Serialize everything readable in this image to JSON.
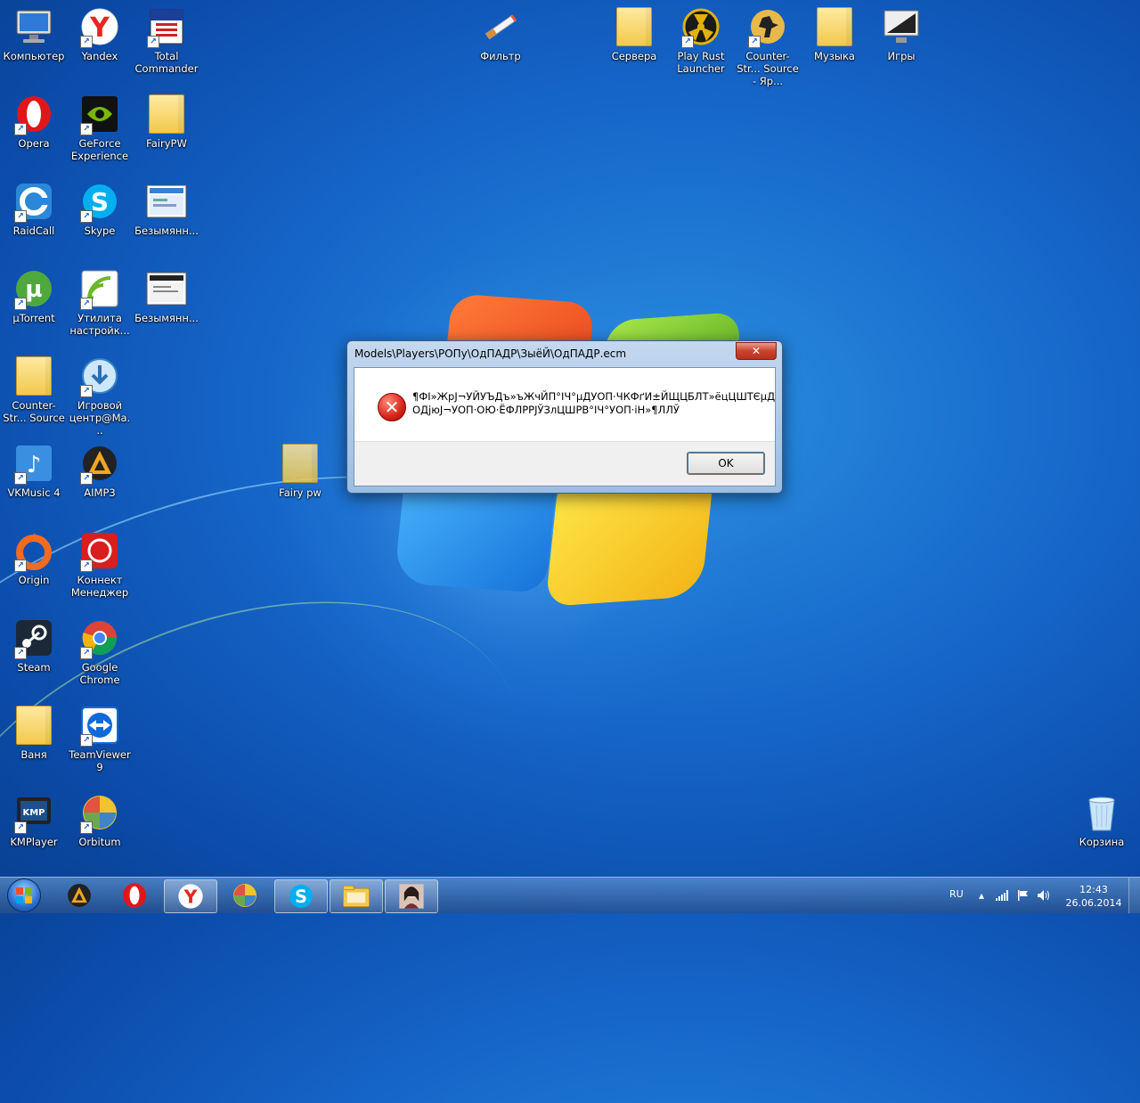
{
  "desktop": {
    "icons": [
      {
        "label": "Компьютер",
        "icon": "computer-icon"
      },
      {
        "label": "Yandex",
        "icon": "yandex-icon"
      },
      {
        "label": "Total Commander",
        "icon": "total-commander-icon"
      },
      {
        "label": "Фильтр",
        "icon": "cigarette-icon"
      },
      {
        "label": "Сервера",
        "icon": "folder-icon"
      },
      {
        "label": "Play Rust Launcher",
        "icon": "rust-icon"
      },
      {
        "label": "Counter-Str... Source - Яр...",
        "icon": "counter-strike-icon"
      },
      {
        "label": "Музыка",
        "icon": "music-folder-icon"
      },
      {
        "label": "Игры",
        "icon": "games-icon"
      },
      {
        "label": "Opera",
        "icon": "opera-icon"
      },
      {
        "label": "GeForce Experience",
        "icon": "geforce-icon"
      },
      {
        "label": "FairyPW",
        "icon": "folder-icon"
      },
      {
        "label": "RaidCall",
        "icon": "raidcall-icon"
      },
      {
        "label": "Skype",
        "icon": "skype-icon"
      },
      {
        "label": "Безымянн...",
        "icon": "image-file-icon"
      },
      {
        "label": "µTorrent",
        "icon": "utorrent-icon"
      },
      {
        "label": "Утилита настройк...",
        "icon": "wifi-utility-icon"
      },
      {
        "label": "Безымянн...",
        "icon": "image-file-icon"
      },
      {
        "label": "Counter-Str... Source",
        "icon": "folder-icon"
      },
      {
        "label": "Игровой центр@Ma...",
        "icon": "game-center-icon"
      },
      {
        "label": "Fairy pw",
        "icon": "folder-icon"
      },
      {
        "label": "VKMusic 4",
        "icon": "vkmusic-icon"
      },
      {
        "label": "AIMP3",
        "icon": "aimp-icon"
      },
      {
        "label": "Origin",
        "icon": "origin-icon"
      },
      {
        "label": "Коннект Менеджер",
        "icon": "connect-manager-icon"
      },
      {
        "label": "Steam",
        "icon": "steam-icon"
      },
      {
        "label": "Google Chrome",
        "icon": "chrome-icon"
      },
      {
        "label": "Ваня",
        "icon": "user-folder-icon"
      },
      {
        "label": "TeamViewer 9",
        "icon": "teamviewer-icon"
      },
      {
        "label": "KMPlayer",
        "icon": "kmplayer-icon"
      },
      {
        "label": "Orbitum",
        "icon": "orbitum-icon"
      },
      {
        "label": "Корзина",
        "icon": "recycle-bin-icon"
      }
    ]
  },
  "dialog": {
    "title": "Models\\Players\\РОПу\\ОдПАДР\\ЗыёЙ\\ОдПАДР.ecm",
    "message": "¶ФІ»ЖрЈ¬УЙУЪДъ»ъЖчЙП°ІЧ°µДУОП·ЧКФґИ±ЙЩЦБЛТ»ёцЦШТЄµД ОДјюЈ¬УОП·ОЮ·ЁФЛРРЈЎЗлЦШРВ°ІЧ°УОП·іН»¶ЛЛЎ",
    "ok_label": "OK",
    "close_label": "✕",
    "icon": "error-icon"
  },
  "taskbar": {
    "start": "start-orb",
    "pinned": [
      {
        "icon": "aimp-icon",
        "active": false
      },
      {
        "icon": "opera-icon",
        "active": false
      },
      {
        "icon": "yandex-icon",
        "active": true
      },
      {
        "icon": "orbitum-icon",
        "active": false
      },
      {
        "icon": "skype-icon",
        "active": true
      },
      {
        "icon": "explorer-icon",
        "active": true
      },
      {
        "icon": "game-avatar-icon",
        "active": true
      }
    ],
    "tray": {
      "language": "RU",
      "time": "12:43",
      "date": "26.06.2014"
    }
  },
  "colors": {
    "desktop_bg": "#1565c8",
    "dialog_frame": "#9bbde2",
    "close_button": "#c9442e",
    "error_red": "#d6251a"
  }
}
